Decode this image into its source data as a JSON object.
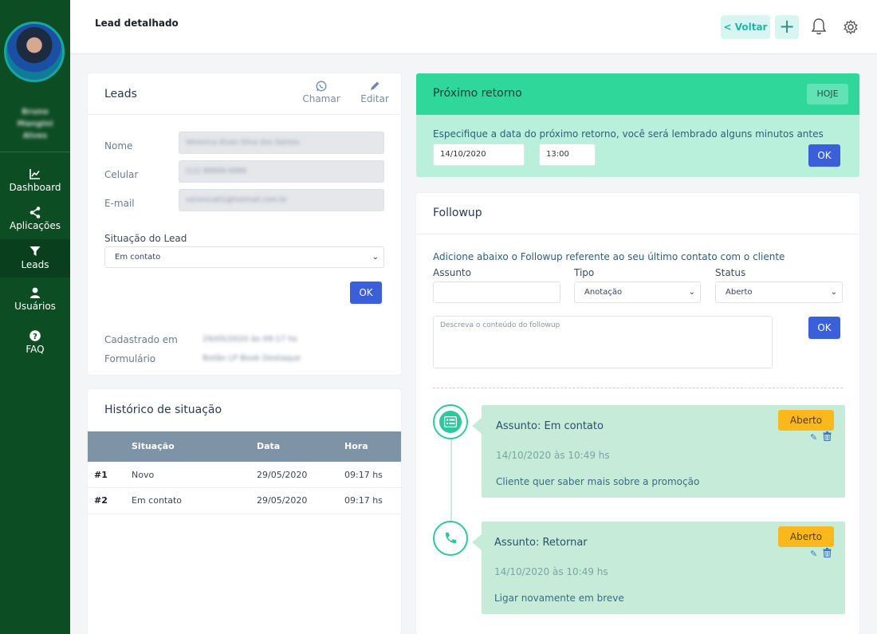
{
  "sidebar": {
    "user_name": "Bruno Mangini Alves",
    "items": [
      {
        "label": "Dashboard",
        "icon": "chart-icon"
      },
      {
        "label": "Aplicações",
        "icon": "share-icon"
      },
      {
        "label": "Leads",
        "icon": "filter-icon"
      },
      {
        "label": "Usuários",
        "icon": "user-icon"
      },
      {
        "label": "FAQ",
        "icon": "question-icon"
      }
    ]
  },
  "topbar": {
    "title": "Lead detalhado",
    "back_label": "< Voltar",
    "add_label": "+"
  },
  "leads": {
    "title": "Leads",
    "chamar_label": "Chamar",
    "editar_label": "Editar",
    "nome_label": "Nome",
    "nome_value": "Veronica Alves Silva dos Santos",
    "celular_label": "Celular",
    "celular_value": "(11) 99999-9999",
    "email_label": "E-mail",
    "email_value": "veronica01@hotmail.com.br",
    "situacao_label": "Situação do Lead",
    "situacao_value": "Em contato",
    "ok_label": "OK",
    "cadastrado_label": "Cadastrado em",
    "cadastrado_value": "29/05/2020 às 09:17 hs",
    "formulario_label": "Formulário",
    "formulario_value": "Botão LP Book Destaque"
  },
  "historico": {
    "title": "Histórico de situação",
    "columns": [
      "Situação",
      "Data",
      "Hora"
    ],
    "rows": [
      {
        "num": "#1",
        "situacao": "Novo",
        "data": "29/05/2020",
        "hora": "09:17 hs"
      },
      {
        "num": "#2",
        "situacao": "Em contato",
        "data": "29/05/2020",
        "hora": "09:17 hs"
      }
    ]
  },
  "retorno": {
    "title": "Próximo retorno",
    "hoje_label": "HOJE",
    "description": "Especifique a data do próximo retorno, você será lembrado alguns minutos antes",
    "date_value": "14/10/2020",
    "time_value": "13:00",
    "ok_label": "OK"
  },
  "followup": {
    "title": "Followup",
    "description": "Adicione abaixo o Followup referente ao seu último contato com o cliente",
    "assunto_label": "Assunto",
    "tipo_label": "Tipo",
    "tipo_value": "Anotação",
    "status_label": "Status",
    "status_value": "Aberto",
    "textarea_placeholder": "Descreva o conteúdo do followup",
    "ok_label": "OK",
    "items": [
      {
        "subject": "Assunto: Em contato",
        "date": "14/10/2020 às 10:49 hs",
        "text": "Cliente quer saber mais sobre a promoção",
        "status": "Aberto",
        "icon": "list-icon"
      },
      {
        "subject": "Assunto: Retornar",
        "date": "14/10/2020 às 10:49 hs",
        "text": "Ligar novamente em breve",
        "status": "Aberto",
        "icon": "phone-icon"
      }
    ]
  }
}
